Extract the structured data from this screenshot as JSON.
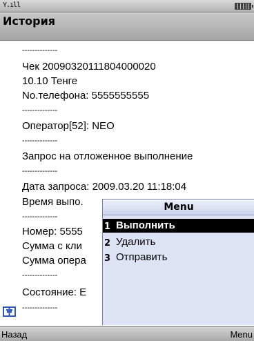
{
  "status": {
    "signal_text": "Y.ıll",
    "battery_icon": "battery-icon"
  },
  "title": "История",
  "content": {
    "lines": [
      "--------------",
      "Чек 20090320111804000020",
      " 10.10 Тенге",
      "No.телефона: 5555555555",
      "--------------",
      "Оператор[52]: NEO",
      "--------------",
      "Запрос на отложенное выполнение",
      "--------------",
      "Дата запроса: 2009.03.20 11:18:04",
      "Время выпо.",
      "--------------",
      "Номер: 5555",
      "Сумма с кли",
      "Сумма опера",
      "--------------",
      "Состояние: Е",
      "--------------"
    ]
  },
  "menu": {
    "title": "Menu",
    "items": [
      {
        "num": "1",
        "label": "Выполнить",
        "selected": true
      },
      {
        "num": "2",
        "label": "Удалить",
        "selected": false
      },
      {
        "num": "3",
        "label": "Отправить",
        "selected": false
      }
    ]
  },
  "softkeys": {
    "left": "Назад",
    "right": "Menu"
  },
  "colors": {
    "menu_bg": "#dde3f5",
    "selection_bg": "#000000",
    "pin_icon": "#2e57c0"
  },
  "icons": {
    "pin": "pin-icon"
  }
}
